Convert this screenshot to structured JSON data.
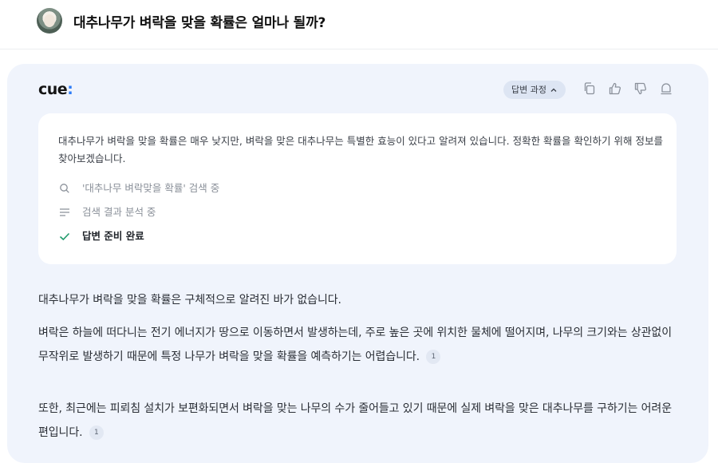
{
  "header": {
    "question": "대추나무가 벼락을 맞을 확률은 얼마나 될까?"
  },
  "response": {
    "logo_text": "cue",
    "logo_colon": ":",
    "process_label": "답변 과정",
    "actions": [
      "copy-icon",
      "thumbs-up-icon",
      "thumbs-down-icon",
      "report-icon"
    ]
  },
  "process": {
    "summary": "대추나무가 벼락을 맞을 확률은 매우 낮지만, 벼락을 맞은 대추나무는 특별한 효능이 있다고 알려져 있습니다. 정확한 확률을 확인하기 위해 정보를 찾아보겠습니다.",
    "steps": [
      {
        "icon": "search-icon",
        "text": "'대추나무 벼락맞을 확률' 검색 중"
      },
      {
        "icon": "lines-icon",
        "text": "검색 결과 분석 중"
      },
      {
        "icon": "check-icon",
        "text": "답변 준비 완료"
      }
    ]
  },
  "answer": {
    "p1": "대추나무가 벼락을 맞을 확률은 구체적으로 알려진 바가 없습니다.",
    "p2": "벼락은 하늘에 떠다니는 전기 에너지가 땅으로 이동하면서 발생하는데, 주로 높은 곳에 위치한 물체에 떨어지며, 나무의 크기와는 상관없이 무작위로 발생하기 때문에 특정 나무가 벼락을 맞을 확률을 예측하기는 어렵습니다.",
    "p2_cite": "1",
    "p3": "또한, 최근에는 피뢰침 설치가 보편화되면서 벼락을 맞는 나무의 수가 줄어들고 있기 때문에 실제 벼락을 맞은 대추나무를 구하기는 어려운 편입니다.",
    "p3_cite": "1"
  }
}
